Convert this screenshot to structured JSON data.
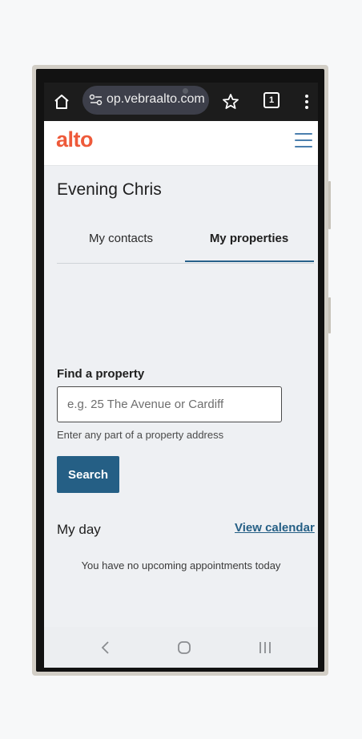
{
  "browser": {
    "url": "op.vebraalto.com",
    "tab_count": "1",
    "icons": [
      "home-icon",
      "site-settings-icon",
      "star-icon",
      "tabs-icon",
      "more-menu-icon"
    ]
  },
  "app": {
    "logo": "alto",
    "brand_color": "#ee5a3a",
    "accent_color": "#255f85"
  },
  "greeting": "Evening Chris",
  "tabs": [
    {
      "label": "My contacts",
      "active": false
    },
    {
      "label": "My properties",
      "active": true
    }
  ],
  "find_property": {
    "label": "Find a property",
    "placeholder": "e.g. 25 The Avenue or Cardiff",
    "value": "",
    "hint": "Enter any part of a property address",
    "button_label": "Search"
  },
  "my_day": {
    "title": "My day",
    "link_label": "View calendar",
    "empty_message": "You have no upcoming appointments today"
  },
  "system_nav": {
    "icons": [
      "back-icon",
      "home-circle-icon",
      "recent-apps-icon"
    ]
  }
}
